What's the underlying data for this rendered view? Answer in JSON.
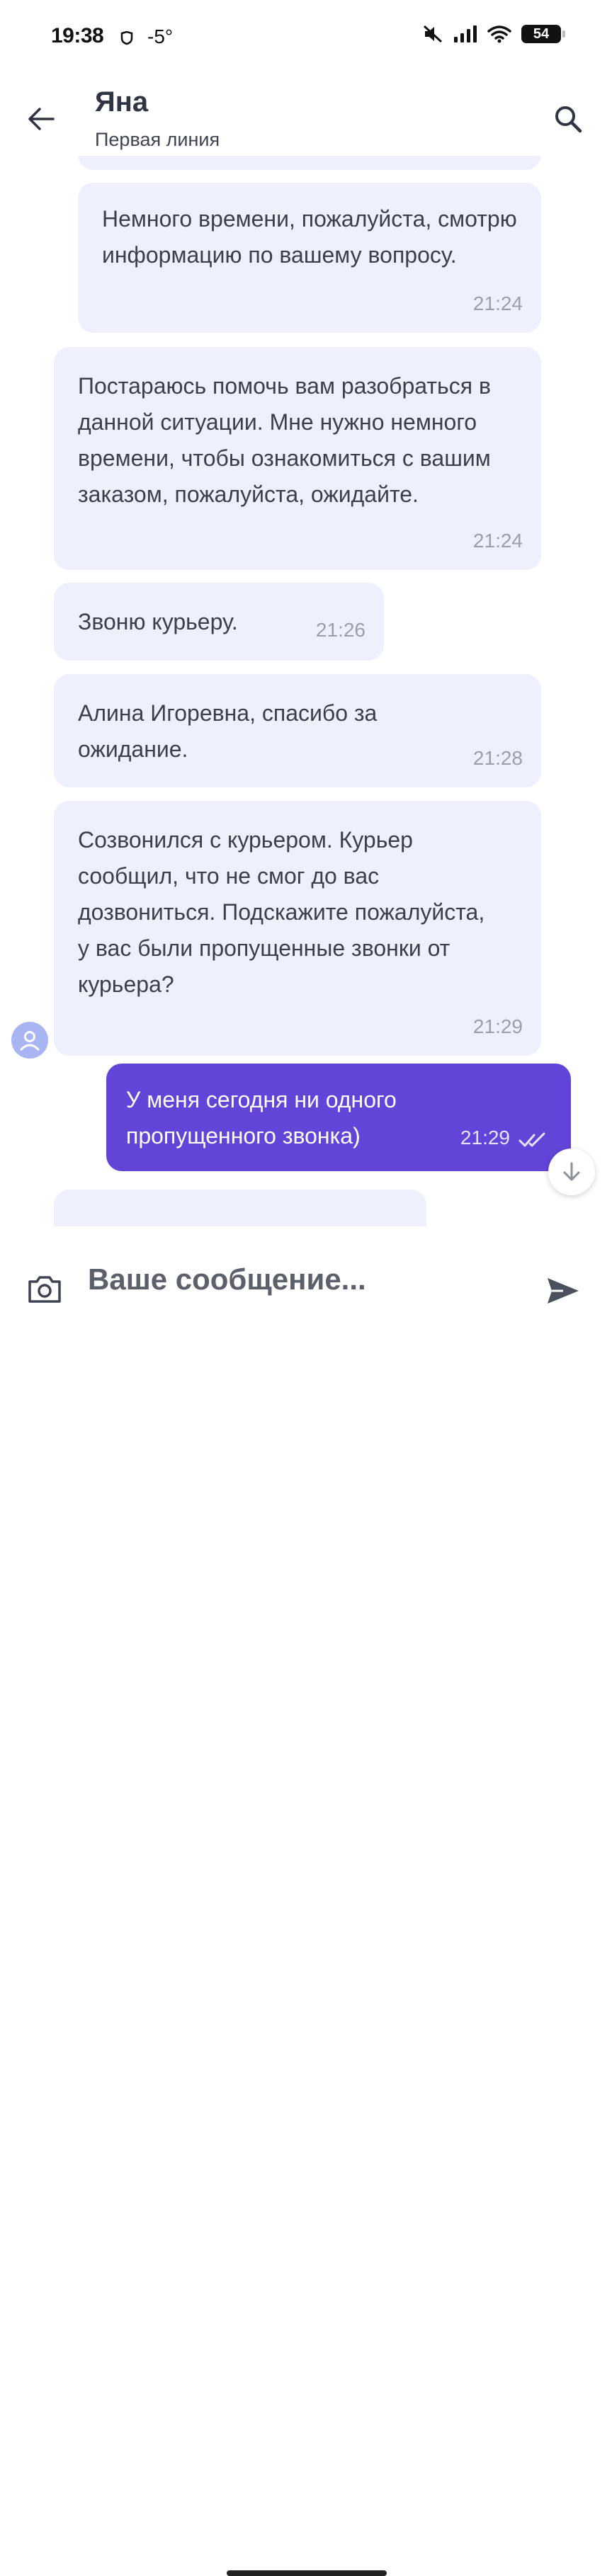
{
  "status_bar": {
    "time": "19:38",
    "temperature": "-5°",
    "battery": "54"
  },
  "header": {
    "title": "Яна",
    "subtitle": "Первая линия"
  },
  "messages": [
    {
      "text": "Немного времени, пожалуйста, смотрю информацию по вашему вопросу.",
      "time": "21:24",
      "direction": "in"
    },
    {
      "text": "Постараюсь помочь вам разобраться в данной ситуации. Мне нужно немного времени, чтобы ознакомиться с вашим заказом, пожалуйста, ожидайте.",
      "time": "21:24",
      "direction": "in"
    },
    {
      "text": "Звоню курьеру.",
      "time": "21:26",
      "direction": "in"
    },
    {
      "text": "Алина Игоревна, спасибо за ожидание.",
      "time": "21:28",
      "direction": "in"
    },
    {
      "text": "Созвонился с курьером. Курьер сообщил, что  не смог до вас дозвониться. Подскажите пожалуйста, у вас были пропущенные звонки от курьера?",
      "time": "21:29",
      "direction": "in"
    },
    {
      "text": "У меня сегодня ни одного пропущенного звонка)",
      "time": "21:29",
      "direction": "out",
      "status": "read"
    }
  ],
  "input": {
    "placeholder": "Ваше сообщение..."
  },
  "colors": {
    "incoming_bubble": "#eef1fd",
    "outgoing_bubble": "#6245d8",
    "accent": "#6245d8"
  },
  "icons": [
    "back-arrow-icon",
    "search-icon",
    "camera-icon",
    "send-icon",
    "chevron-down-icon",
    "user-avatar-icon",
    "double-check-icon"
  ]
}
